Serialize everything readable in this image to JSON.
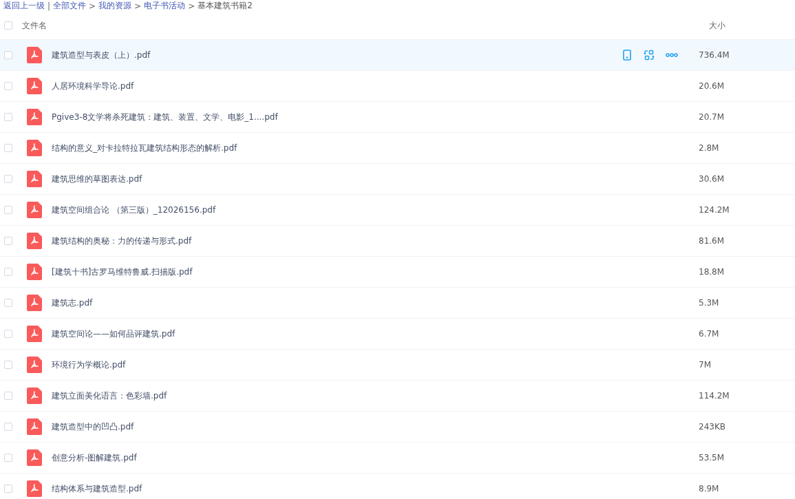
{
  "breadcrumb": [
    {
      "kind": "link",
      "text": "返回上一级"
    },
    {
      "kind": "separator",
      "text": "|"
    },
    {
      "kind": "link",
      "text": "全部文件"
    },
    {
      "kind": "separator",
      "text": ">"
    },
    {
      "kind": "link",
      "text": "我的资源"
    },
    {
      "kind": "separator",
      "text": ">"
    },
    {
      "kind": "link",
      "text": "电子书活动"
    },
    {
      "kind": "separator",
      "text": ">"
    },
    {
      "kind": "current",
      "text": "基本建筑书籍2"
    }
  ],
  "table": {
    "columns": [
      "文件名",
      "大小"
    ],
    "select_all": {
      "checked": false
    },
    "rows": [
      {
        "name": "建筑造型与表皮（上）.pdf",
        "size": "736.4M",
        "checked": false,
        "hovered": true
      },
      {
        "name": "人居环境科学导论.pdf",
        "size": "20.6M",
        "checked": false,
        "hovered": false
      },
      {
        "name": "Pgive3-8文学将杀死建筑：建筑、装置、文学、电影_1....pdf",
        "size": "20.7M",
        "checked": false,
        "hovered": false
      },
      {
        "name": "结构的意义_对卡拉特拉瓦建筑结构形态的解析.pdf",
        "size": "2.8M",
        "checked": false,
        "hovered": false
      },
      {
        "name": "建筑思维的草图表达.pdf",
        "size": "30.6M",
        "checked": false,
        "hovered": false
      },
      {
        "name": "建筑空间组合论 （第三版）_12026156.pdf",
        "size": "124.2M",
        "checked": false,
        "hovered": false
      },
      {
        "name": "建筑结构的奥秘：力的传递与形式.pdf",
        "size": "81.6M",
        "checked": false,
        "hovered": false
      },
      {
        "name": "[建筑十书]古罗马维特鲁威.扫描版.pdf",
        "size": "18.8M",
        "checked": false,
        "hovered": false
      },
      {
        "name": "建筑志.pdf",
        "size": "5.3M",
        "checked": false,
        "hovered": false
      },
      {
        "name": "建筑空间论——如何品评建筑.pdf",
        "size": "6.7M",
        "checked": false,
        "hovered": false
      },
      {
        "name": "环境行为学概论.pdf",
        "size": "7M",
        "checked": false,
        "hovered": false
      },
      {
        "name": "建筑立面美化语言：色彩墙.pdf",
        "size": "114.2M",
        "checked": false,
        "hovered": false
      },
      {
        "name": "建筑造型中的凹凸.pdf",
        "size": "243KB",
        "checked": false,
        "hovered": false
      },
      {
        "name": "创意分析-图解建筑.pdf",
        "size": "53.5M",
        "checked": false,
        "hovered": false
      },
      {
        "name": "结构体系与建筑造型.pdf",
        "size": "8.9M",
        "checked": false,
        "hovered": false
      }
    ]
  }
}
